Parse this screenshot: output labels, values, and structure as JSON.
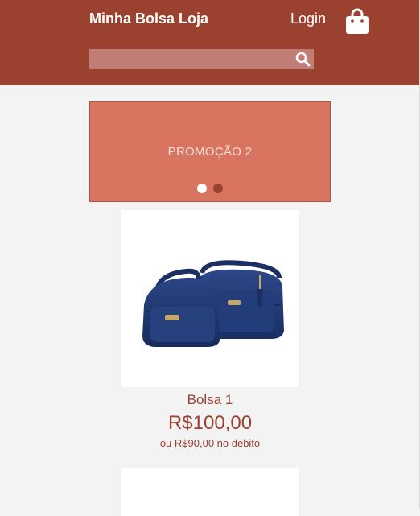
{
  "header": {
    "brand": "Minha Bolsa Loja",
    "login_label": "Login",
    "cart_icon": "shopping-bag-icon",
    "search": {
      "placeholder": "",
      "value": "",
      "icon": "search-icon"
    }
  },
  "banner": {
    "text": "PROMOÇÃO 2",
    "dots": [
      {
        "active": true
      },
      {
        "active": false
      }
    ]
  },
  "products": [
    {
      "name": "Bolsa 1",
      "price": "R$100,00",
      "debit_price": "ou R$90,00 no debito",
      "image_icon": "navy-handbag-image"
    },
    {
      "image_icon": "product-image"
    }
  ],
  "colors": {
    "header_bg": "#9b4130",
    "banner_bg": "#d8745f",
    "text_accent": "#9b4130",
    "page_bg": "#f3f3f4",
    "bag_navy": "#1f3670"
  }
}
